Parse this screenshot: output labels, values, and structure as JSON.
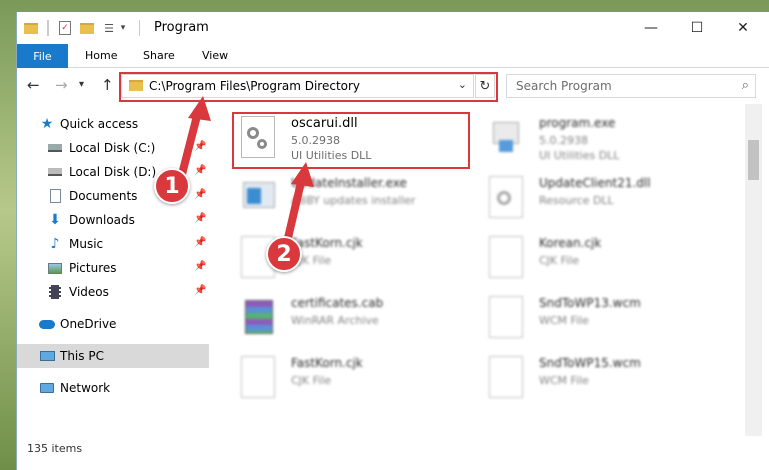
{
  "window": {
    "title": "Program",
    "controls": {
      "minimize": "—",
      "maximize": "☐",
      "close": "✕"
    }
  },
  "ribbon": {
    "file": "File",
    "tabs": [
      "Home",
      "Share",
      "View"
    ]
  },
  "address": {
    "path": "C:\\Program Files\\Program Directory",
    "search_placeholder": "Search Program"
  },
  "sidebar": {
    "items": [
      {
        "label": "Quick access",
        "icon": "star-icon"
      },
      {
        "label": "Local Disk (C:)",
        "icon": "drive-icon"
      },
      {
        "label": "Local Disk (D:)",
        "icon": "drive-icon"
      },
      {
        "label": "Documents",
        "icon": "documents-icon"
      },
      {
        "label": "Downloads",
        "icon": "download-icon"
      },
      {
        "label": "Music",
        "icon": "music-icon"
      },
      {
        "label": "Pictures",
        "icon": "pictures-icon"
      },
      {
        "label": "Videos",
        "icon": "videos-icon"
      },
      {
        "label": "OneDrive",
        "icon": "cloud-icon"
      },
      {
        "label": "This PC",
        "icon": "computer-icon"
      },
      {
        "label": "Network",
        "icon": "network-icon"
      }
    ]
  },
  "files": [
    {
      "name": "oscarui.dll",
      "line2": "5.0.2938",
      "line3": "UI Utilities DLL"
    },
    {
      "name": "program.exe",
      "line2": "5.0.2938",
      "line3": "UI Utilities DLL"
    },
    {
      "name": "UpdateInstaller.exe",
      "line2": "ABBY updates installer",
      "line3": ""
    },
    {
      "name": "UpdateClient21.dll",
      "line2": "Resource DLL",
      "line3": ""
    },
    {
      "name": "FastKorn.cjk",
      "line2": "CJK File",
      "line3": ""
    },
    {
      "name": "Korean.cjk",
      "line2": "CJK File",
      "line3": ""
    },
    {
      "name": "certificates.cab",
      "line2": "WinRAR Archive",
      "line3": ""
    },
    {
      "name": "SndToWP13.wcm",
      "line2": "WCM File",
      "line3": ""
    },
    {
      "name": "FastKorn.cjk",
      "line2": "CJK File",
      "line3": ""
    },
    {
      "name": "SndToWP15.wcm",
      "line2": "WCM File",
      "line3": ""
    }
  ],
  "status": {
    "items": "135 items"
  },
  "callouts": {
    "one": "1",
    "two": "2"
  },
  "colors": {
    "accent": "#1979ca",
    "highlight": "#d9383d"
  }
}
